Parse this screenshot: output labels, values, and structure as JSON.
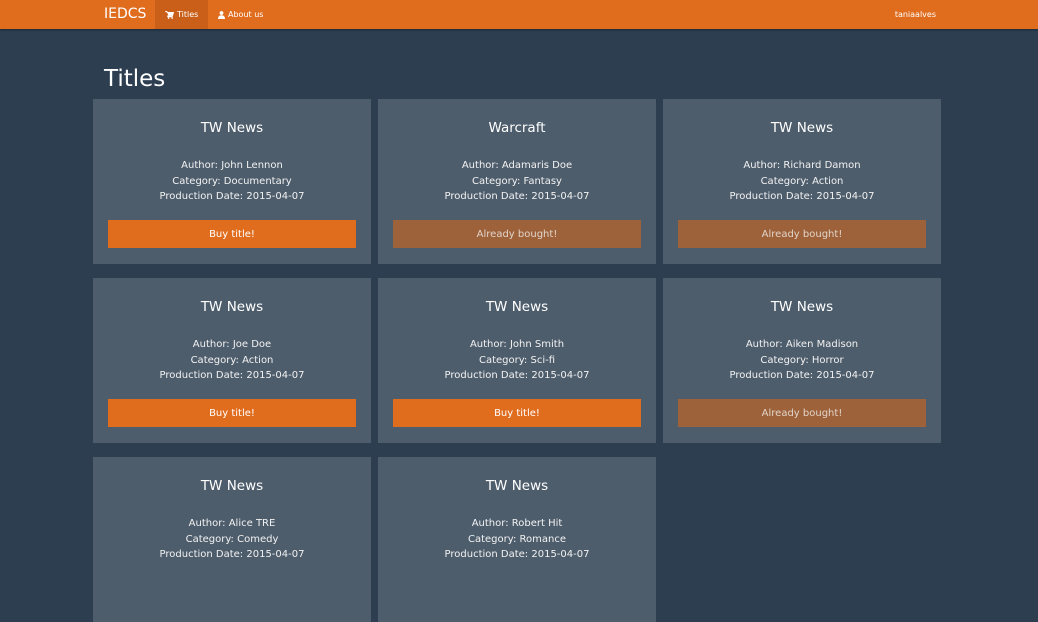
{
  "navbar": {
    "brand": "IEDCS",
    "items": [
      {
        "label": "Titles",
        "icon": "cart-icon",
        "active": true
      },
      {
        "label": "About us",
        "icon": "user-icon",
        "active": false
      }
    ],
    "user": "taniaalves"
  },
  "page": {
    "heading": "Titles"
  },
  "author_prefix": "Author: ",
  "category_prefix": "Category: ",
  "date_prefix": "Production Date: ",
  "titles": [
    {
      "title": "TW News",
      "author": "John Lennon",
      "category": "Documentary",
      "date": "2015-04-07",
      "button": "Buy title!",
      "state": "buy"
    },
    {
      "title": "Warcraft",
      "author": "Adamaris Doe",
      "category": "Fantasy",
      "date": "2015-04-07",
      "button": "Already bought!",
      "state": "bought"
    },
    {
      "title": "TW News",
      "author": "Richard Damon",
      "category": "Action",
      "date": "2015-04-07",
      "button": "Already bought!",
      "state": "bought"
    },
    {
      "title": "TW News",
      "author": "Joe Doe",
      "category": "Action",
      "date": "2015-04-07",
      "button": "Buy title!",
      "state": "buy"
    },
    {
      "title": "TW News",
      "author": "John Smith",
      "category": "Sci-fi",
      "date": "2015-04-07",
      "button": "Buy title!",
      "state": "buy"
    },
    {
      "title": "TW News",
      "author": "Aiken Madison",
      "category": "Horror",
      "date": "2015-04-07",
      "button": "Already bought!",
      "state": "bought"
    },
    {
      "title": "TW News",
      "author": "Alice TRE",
      "category": "Comedy",
      "date": "2015-04-07",
      "button": "",
      "state": "hidden"
    },
    {
      "title": "TW News",
      "author": "Robert Hit",
      "category": "Romance",
      "date": "2015-04-07",
      "button": "",
      "state": "hidden"
    }
  ],
  "colors": {
    "navbar": "#e06c1e",
    "background": "#2c3e50",
    "card": "#4e5d6c",
    "buy_button": "#e06c1e",
    "bought_button": "#9e623b"
  }
}
